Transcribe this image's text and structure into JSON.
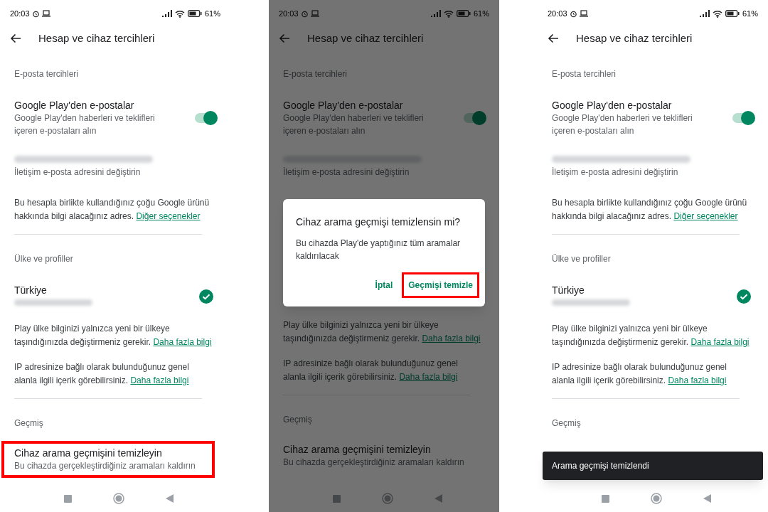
{
  "screens": [
    {
      "dimmed": false,
      "status_bar": {
        "time": "20:03",
        "battery": "61%"
      },
      "title": "Hesap ve cihaz tercihleri",
      "rows": [
        {
          "kind": "section",
          "text": "E-posta tercihleri"
        },
        {
          "kind": "toggle",
          "title": "Google Play'den e-postalar",
          "subtitle": "Google Play'den haberleri ve teklifleri içeren e-postaları alın",
          "on": true
        },
        {
          "kind": "email",
          "subtitle": "İletişim e-posta adresini değiştirin"
        },
        {
          "kind": "info",
          "text": "Bu hesapla birlikte kullandığınız çoğu Google ürünü hakkında bilgi alacağınız adres.",
          "link": "Diğer seçenekler"
        },
        {
          "kind": "divider"
        },
        {
          "kind": "section",
          "text": "Ülke ve profiller"
        },
        {
          "kind": "country",
          "title": "Türkiye",
          "checked": true
        },
        {
          "kind": "info",
          "text": "Play ülke bilginizi yalnızca yeni bir ülkeye taşındığınızda değiştirmeniz gerekir.",
          "link": "Daha fazla bilgi"
        },
        {
          "kind": "info",
          "text": "IP adresinize bağlı olarak bulunduğunuz genel alanla ilgili içerik görebilirsiniz.",
          "link": "Daha fazla bilgi"
        },
        {
          "kind": "divider"
        },
        {
          "kind": "section",
          "text": "Geçmiş"
        },
        {
          "kind": "action",
          "title": "Cihaz arama geçmişini temizleyin",
          "subtitle": "Bu cihazda gerçekleştirdiğiniz aramaları kaldırın",
          "highlighted": true
        }
      ]
    },
    {
      "dimmed": true,
      "status_bar": {
        "time": "20:03",
        "battery": "61%"
      },
      "title": "Hesap ve cihaz tercihleri",
      "rows": [
        {
          "kind": "section",
          "text": "E-posta tercihleri"
        },
        {
          "kind": "toggle",
          "title": "Google Play'den e-postalar",
          "subtitle": "Google Play'den haberleri ve teklifleri içeren e-postaları alın",
          "on": true
        },
        {
          "kind": "email",
          "subtitle": "İletişim e-posta adresini değiştirin"
        },
        {
          "kind": "spacer"
        },
        {
          "kind": "info",
          "text": "Play ülke bilginizi yalnızca yeni bir ülkeye taşındığınızda değiştirmeniz gerekir.",
          "link": "Daha fazla bilgi"
        },
        {
          "kind": "info",
          "text": "IP adresinize bağlı olarak bulunduğunuz genel alanla ilgili içerik görebilirsiniz.",
          "link": "Daha fazla bilgi"
        },
        {
          "kind": "divider"
        },
        {
          "kind": "section",
          "text": "Geçmiş"
        },
        {
          "kind": "action",
          "title": "Cihaz arama geçmişini temizleyin",
          "subtitle": "Bu cihazda gerçekleştirdiğiniz aramaları kaldırın",
          "highlighted": false
        }
      ],
      "dialog": {
        "title": "Cihaz arama geçmişi temizlensin mi?",
        "message": "Bu cihazda Play'de yaptığınız tüm aramalar kaldırılacak",
        "buttons": [
          {
            "label": "İptal",
            "highlighted": false
          },
          {
            "label": "Geçmişi temizle",
            "highlighted": true
          }
        ]
      }
    },
    {
      "dimmed": false,
      "status_bar": {
        "time": "20:03",
        "battery": "61%"
      },
      "title": "Hesap ve cihaz tercihleri",
      "rows": [
        {
          "kind": "section",
          "text": "E-posta tercihleri"
        },
        {
          "kind": "toggle",
          "title": "Google Play'den e-postalar",
          "subtitle": "Google Play'den haberleri ve teklifleri içeren e-postaları alın",
          "on": true
        },
        {
          "kind": "email",
          "subtitle": "İletişim e-posta adresini değiştirin"
        },
        {
          "kind": "info",
          "text": "Bu hesapla birlikte kullandığınız çoğu Google ürünü hakkında bilgi alacağınız adres.",
          "link": "Diğer seçenekler"
        },
        {
          "kind": "divider"
        },
        {
          "kind": "section",
          "text": "Ülke ve profiller"
        },
        {
          "kind": "country",
          "title": "Türkiye",
          "checked": true
        },
        {
          "kind": "info",
          "text": "Play ülke bilginizi yalnızca yeni bir ülkeye taşındığınızda değiştirmeniz gerekir.",
          "link": "Daha fazla bilgi"
        },
        {
          "kind": "info",
          "text": "IP adresinize bağlı olarak bulunduğunuz genel alanla ilgili içerik görebilirsiniz.",
          "link": "Daha fazla bilgi"
        },
        {
          "kind": "divider"
        },
        {
          "kind": "section",
          "text": "Geçmiş"
        }
      ],
      "snackbar": {
        "text": "Arama geçmişi temizlendi"
      }
    }
  ]
}
